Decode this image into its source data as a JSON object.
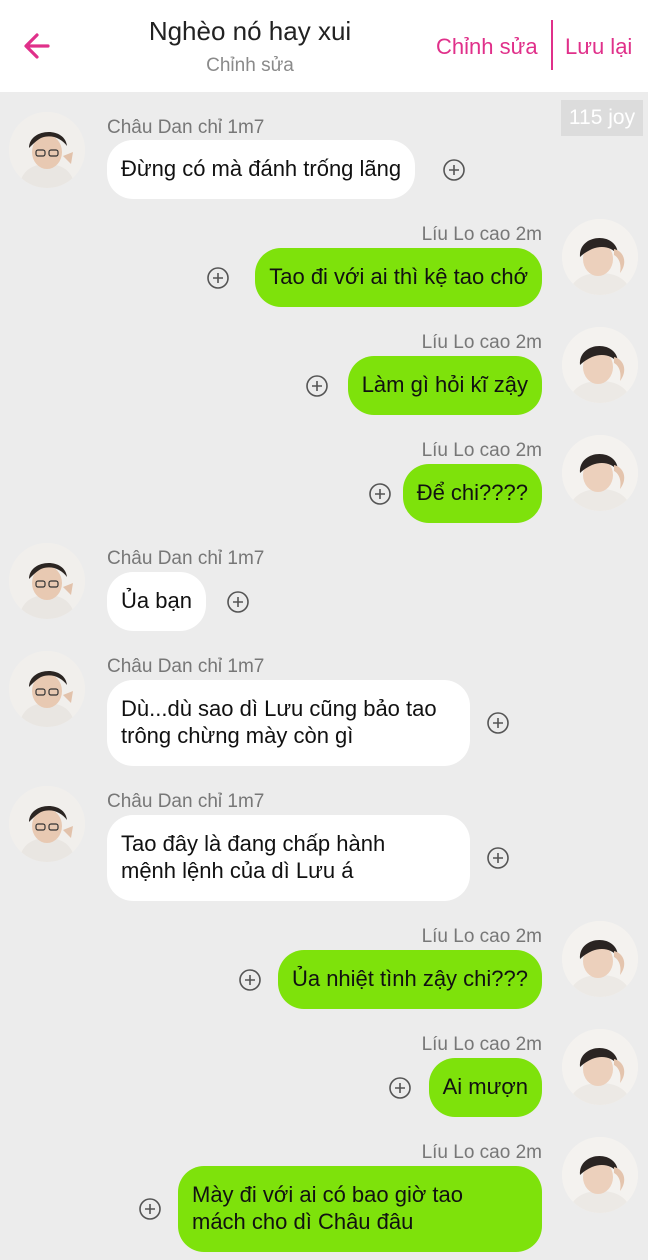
{
  "header": {
    "title": "Nghèo nó hay xui",
    "subtitle": "Chỉnh sửa",
    "edit_label": "Chỉnh sửa",
    "save_label": "Lưu lại",
    "back_icon": "arrow-left-icon",
    "accent_color": "#e0308a"
  },
  "watermark": "115 joy",
  "colors": {
    "incoming_bubble": "#ffffff",
    "outgoing_bubble": "#7ee20b",
    "background": "#ececec"
  },
  "messages": [
    {
      "side": "left",
      "sender": "Châu Dan chỉ 1m7",
      "lines": [
        "Đừng có mà đánh trống lãng"
      ]
    },
    {
      "side": "right",
      "sender": "Líu Lo cao 2m",
      "lines": [
        "Tao đi với ai thì kệ tao chớ"
      ]
    },
    {
      "side": "right",
      "sender": "Líu Lo cao 2m",
      "lines": [
        "Làm gì hỏi kĩ zậy"
      ]
    },
    {
      "side": "right",
      "sender": "Líu Lo cao 2m",
      "lines": [
        "Để chi????"
      ]
    },
    {
      "side": "left",
      "sender": "Châu Dan chỉ 1m7",
      "lines": [
        "Ủa bạn"
      ]
    },
    {
      "side": "left",
      "sender": "Châu Dan chỉ 1m7",
      "lines": [
        "Dù...dù sao dì Lưu cũng bảo tao",
        "trông chừng mày còn gì"
      ]
    },
    {
      "side": "left",
      "sender": "Châu Dan chỉ 1m7",
      "lines": [
        "Tao đây là đang chấp hành",
        "mệnh lệnh của dì Lưu á"
      ]
    },
    {
      "side": "right",
      "sender": "Líu Lo cao 2m",
      "lines": [
        "Ủa nhiệt tình zậy chi???"
      ]
    },
    {
      "side": "right",
      "sender": "Líu Lo cao 2m",
      "lines": [
        "Ai mượn"
      ]
    },
    {
      "side": "right",
      "sender": "Líu Lo cao 2m",
      "lines": [
        "Mày đi với ai có bao giờ tao",
        "mách cho dì Châu đâu"
      ]
    }
  ]
}
